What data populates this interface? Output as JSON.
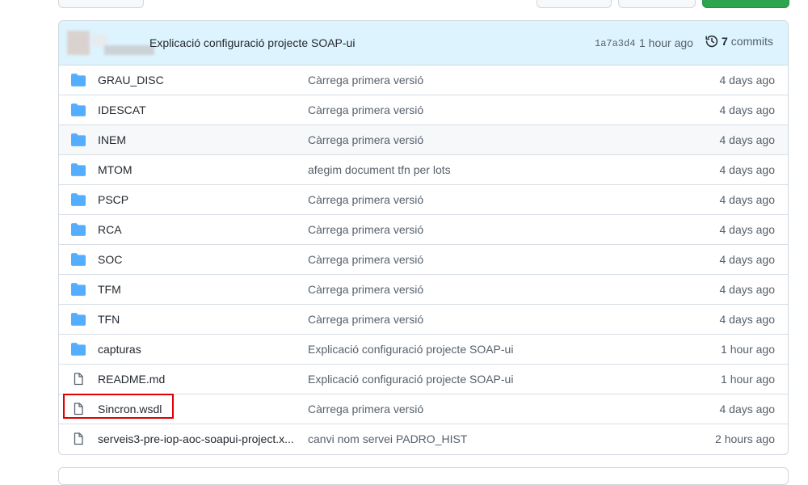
{
  "commit": {
    "message": "Explicació configuració projecte SOAP-ui",
    "sha": "1a7a3d4",
    "time": "1 hour ago",
    "commits_count": "7",
    "commits_label": "commits"
  },
  "files": [
    {
      "name": "GRAU_DISC",
      "type": "folder",
      "message": "Càrrega primera versió",
      "age": "4 days ago"
    },
    {
      "name": "IDESCAT",
      "type": "folder",
      "message": "Càrrega primera versió",
      "age": "4 days ago"
    },
    {
      "name": "INEM",
      "type": "folder",
      "message": "Càrrega primera versió",
      "age": "4 days ago"
    },
    {
      "name": "MTOM",
      "type": "folder",
      "message": "afegim document tfn per lots",
      "age": "4 days ago"
    },
    {
      "name": "PSCP",
      "type": "folder",
      "message": "Càrrega primera versió",
      "age": "4 days ago"
    },
    {
      "name": "RCA",
      "type": "folder",
      "message": "Càrrega primera versió",
      "age": "4 days ago"
    },
    {
      "name": "SOC",
      "type": "folder",
      "message": "Càrrega primera versió",
      "age": "4 days ago"
    },
    {
      "name": "TFM",
      "type": "folder",
      "message": "Càrrega primera versió",
      "age": "4 days ago"
    },
    {
      "name": "TFN",
      "type": "folder",
      "message": "Càrrega primera versió",
      "age": "4 days ago"
    },
    {
      "name": "capturas",
      "type": "folder",
      "message": "Explicació configuració projecte SOAP-ui",
      "age": "1 hour ago"
    },
    {
      "name": "README.md",
      "type": "file",
      "message": "Explicació configuració projecte SOAP-ui",
      "age": "1 hour ago"
    },
    {
      "name": "Sincron.wsdl",
      "type": "file",
      "message": "Càrrega primera versió",
      "age": "4 days ago"
    },
    {
      "name": "serveis3-pre-iop-aoc-soapui-project.x...",
      "type": "file",
      "message": "canvi nom servei PADRO_HIST",
      "age": "2 hours ago"
    }
  ],
  "colors": {
    "folder": "#54aeff",
    "highlight": "#e00000",
    "commit_bg": "#ddf4ff"
  }
}
